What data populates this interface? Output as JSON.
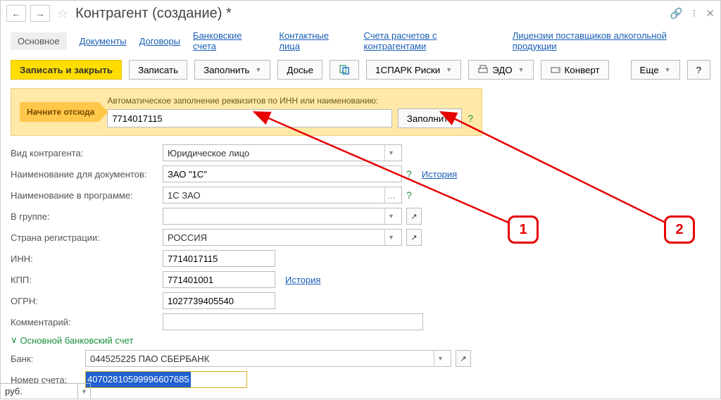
{
  "title": "Контрагент (создание) *",
  "tabs": {
    "main": "Основное",
    "links": [
      "Документы",
      "Договоры",
      "Банковские счета",
      "Контактные лица",
      "Счета расчетов с контрагентами",
      "Лицензии поставщиков алкогольной продукции"
    ]
  },
  "toolbar": {
    "save_close": "Записать и закрыть",
    "save": "Записать",
    "fill": "Заполнить",
    "dossier": "Досье",
    "spark": "1СПАРК Риски",
    "edo": "ЭДО",
    "envelope": "Конверт",
    "more": "Еще",
    "help": "?"
  },
  "start": {
    "arrow": "Начните отсюда",
    "label": "Автоматическое заполнение реквизитов по ИНН или наименованию:",
    "value": "7714017115",
    "fill": "Заполнить",
    "help": "?"
  },
  "form": {
    "type_label": "Вид контрагента:",
    "type_value": "Юридическое лицо",
    "docname_label": "Наименование для документов:",
    "docname_value": "ЗАО \"1С\"",
    "docname_history": "История",
    "progname_label": "Наименование в программе:",
    "progname_value": "1С ЗАО",
    "group_label": "В группе:",
    "group_value": "",
    "country_label": "Страна регистрации:",
    "country_value": "РОССИЯ",
    "inn_label": "ИНН:",
    "inn_value": "7714017115",
    "kpp_label": "КПП:",
    "kpp_value": "771401001",
    "kpp_history": "История",
    "ogrn_label": "ОГРН:",
    "ogrn_value": "1027739405540",
    "comment_label": "Комментарий:",
    "comment_value": ""
  },
  "bank": {
    "header": "Основной банковский счет",
    "bank_label": "Банк:",
    "bank_value": "044525225 ПАО СБЕРБАНК",
    "account_label": "Номер счета:",
    "account_value": "40702810599996607685",
    "currency": "руб."
  },
  "callouts": {
    "one": "1",
    "two": "2"
  }
}
